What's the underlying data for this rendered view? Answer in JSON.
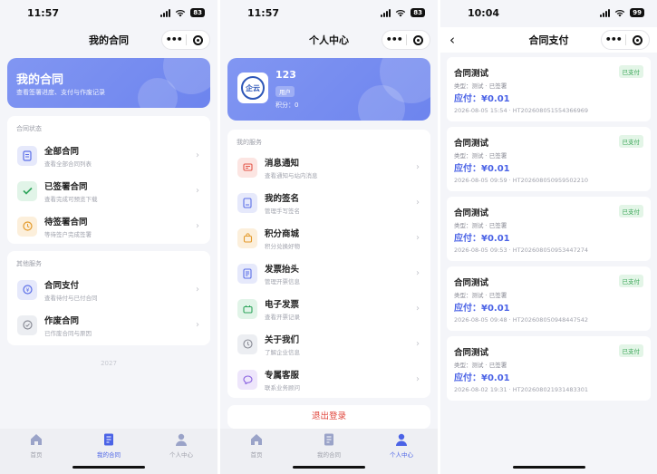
{
  "screen1": {
    "status_time": "11:57",
    "battery": "83",
    "title": "我的合同",
    "more": "•••",
    "hero": {
      "title": "我的合同",
      "subtitle": "查看签署进度、支付与作废记录"
    },
    "status_section": {
      "label": "合同状态",
      "items": [
        {
          "title": "全部合同",
          "sub": "查看全部合同列表",
          "icon": "document-icon",
          "color": "#5b6fe8",
          "bg": "#e6e9fb"
        },
        {
          "title": "已签署合同",
          "sub": "查看完成可预览下载",
          "icon": "check-icon",
          "color": "#2fa55c",
          "bg": "#e1f4e8"
        },
        {
          "title": "待签署合同",
          "sub": "等待签户完成签署",
          "icon": "clock-icon",
          "color": "#e39a2b",
          "bg": "#fcefdb"
        }
      ]
    },
    "other_section": {
      "label": "其他服务",
      "items": [
        {
          "title": "合同支付",
          "sub": "查看待付与已付合同",
          "icon": "payment-icon",
          "color": "#5b6fe8",
          "bg": "#e6e9fb"
        },
        {
          "title": "作废合同",
          "sub": "已作废合同与原因",
          "icon": "void-icon",
          "color": "#8a8c96",
          "bg": "#eceef2"
        }
      ]
    },
    "footer_year": "2027",
    "tabs": [
      {
        "label": "首页",
        "icon": "home-icon"
      },
      {
        "label": "我的合同",
        "icon": "contract-icon"
      },
      {
        "label": "个人中心",
        "icon": "person-icon"
      }
    ],
    "active_tab": 1
  },
  "screen2": {
    "status_time": "11:57",
    "battery": "83",
    "title": "个人中心",
    "more": "•••",
    "profile": {
      "logo_text": "企云",
      "name": "123",
      "role_badge": "用户",
      "points_label": "积分：0"
    },
    "services_label": "我的服务",
    "items": [
      {
        "title": "消息通知",
        "sub": "查看通知与站内消息",
        "icon": "message-icon",
        "color": "#e4574a",
        "bg": "#fce5e2"
      },
      {
        "title": "我的签名",
        "sub": "管理手写签名",
        "icon": "signature-icon",
        "color": "#5b6fe8",
        "bg": "#e6e9fb"
      },
      {
        "title": "积分商城",
        "sub": "积分兑换好物",
        "icon": "shop-bag-icon",
        "color": "#e39a2b",
        "bg": "#fcefdb"
      },
      {
        "title": "发票抬头",
        "sub": "管理开票信息",
        "icon": "invoice-header-icon",
        "color": "#5b6fe8",
        "bg": "#e6e9fb"
      },
      {
        "title": "电子发票",
        "sub": "查看开票记录",
        "icon": "invoice-icon",
        "color": "#2fa55c",
        "bg": "#e1f4e8"
      },
      {
        "title": "关于我们",
        "sub": "了解企业信息",
        "icon": "info-icon",
        "color": "#8a8c96",
        "bg": "#eceef2"
      },
      {
        "title": "专属客服",
        "sub": "联系业务顾问",
        "icon": "chat-icon",
        "color": "#8a62e0",
        "bg": "#eee6fb"
      }
    ],
    "logout_label": "退出登录",
    "tabs": [
      {
        "label": "首页",
        "icon": "home-icon"
      },
      {
        "label": "我的合同",
        "icon": "contract-icon"
      },
      {
        "label": "个人中心",
        "icon": "person-icon"
      }
    ],
    "active_tab": 2
  },
  "screen3": {
    "status_time": "10:04",
    "battery": "99",
    "title": "合同支付",
    "more": "•••",
    "back": "‹",
    "payments": [
      {
        "title": "合同测试",
        "status": "已支付",
        "type": "类型：测试 · 已签署",
        "amount": "应付：¥0.01",
        "footer": "2026-08-05 15:54 · HT20260805155436696​9"
      },
      {
        "title": "合同测试",
        "status": "已支付",
        "type": "类型：测试 · 已签署",
        "amount": "应付：¥0.01",
        "footer": "2026-08-05 09:59 · HT20260805095950221​0"
      },
      {
        "title": "合同测试",
        "status": "已支付",
        "type": "类型：测试 · 已签署",
        "amount": "应付：¥0.01",
        "footer": "2026-08-05 09:53 · HT20260805095344727​4"
      },
      {
        "title": "合同测试",
        "status": "已支付",
        "type": "类型：测试 · 已签署",
        "amount": "应付：¥0.01",
        "footer": "2026-08-05 09:48 · HT20260805094844754​2"
      },
      {
        "title": "合同测试",
        "status": "已支付",
        "type": "类型：测试 · 已签署",
        "amount": "应付：¥0.01",
        "footer": "2026-08-02 19:31 · HT20260802193148330​1"
      }
    ]
  },
  "colors": {
    "accent": "#4b63e6",
    "hero_start": "#8196f2",
    "hero_end": "#6d84ee",
    "paid_green": "#3aa657",
    "logout_red": "#e0443a"
  }
}
